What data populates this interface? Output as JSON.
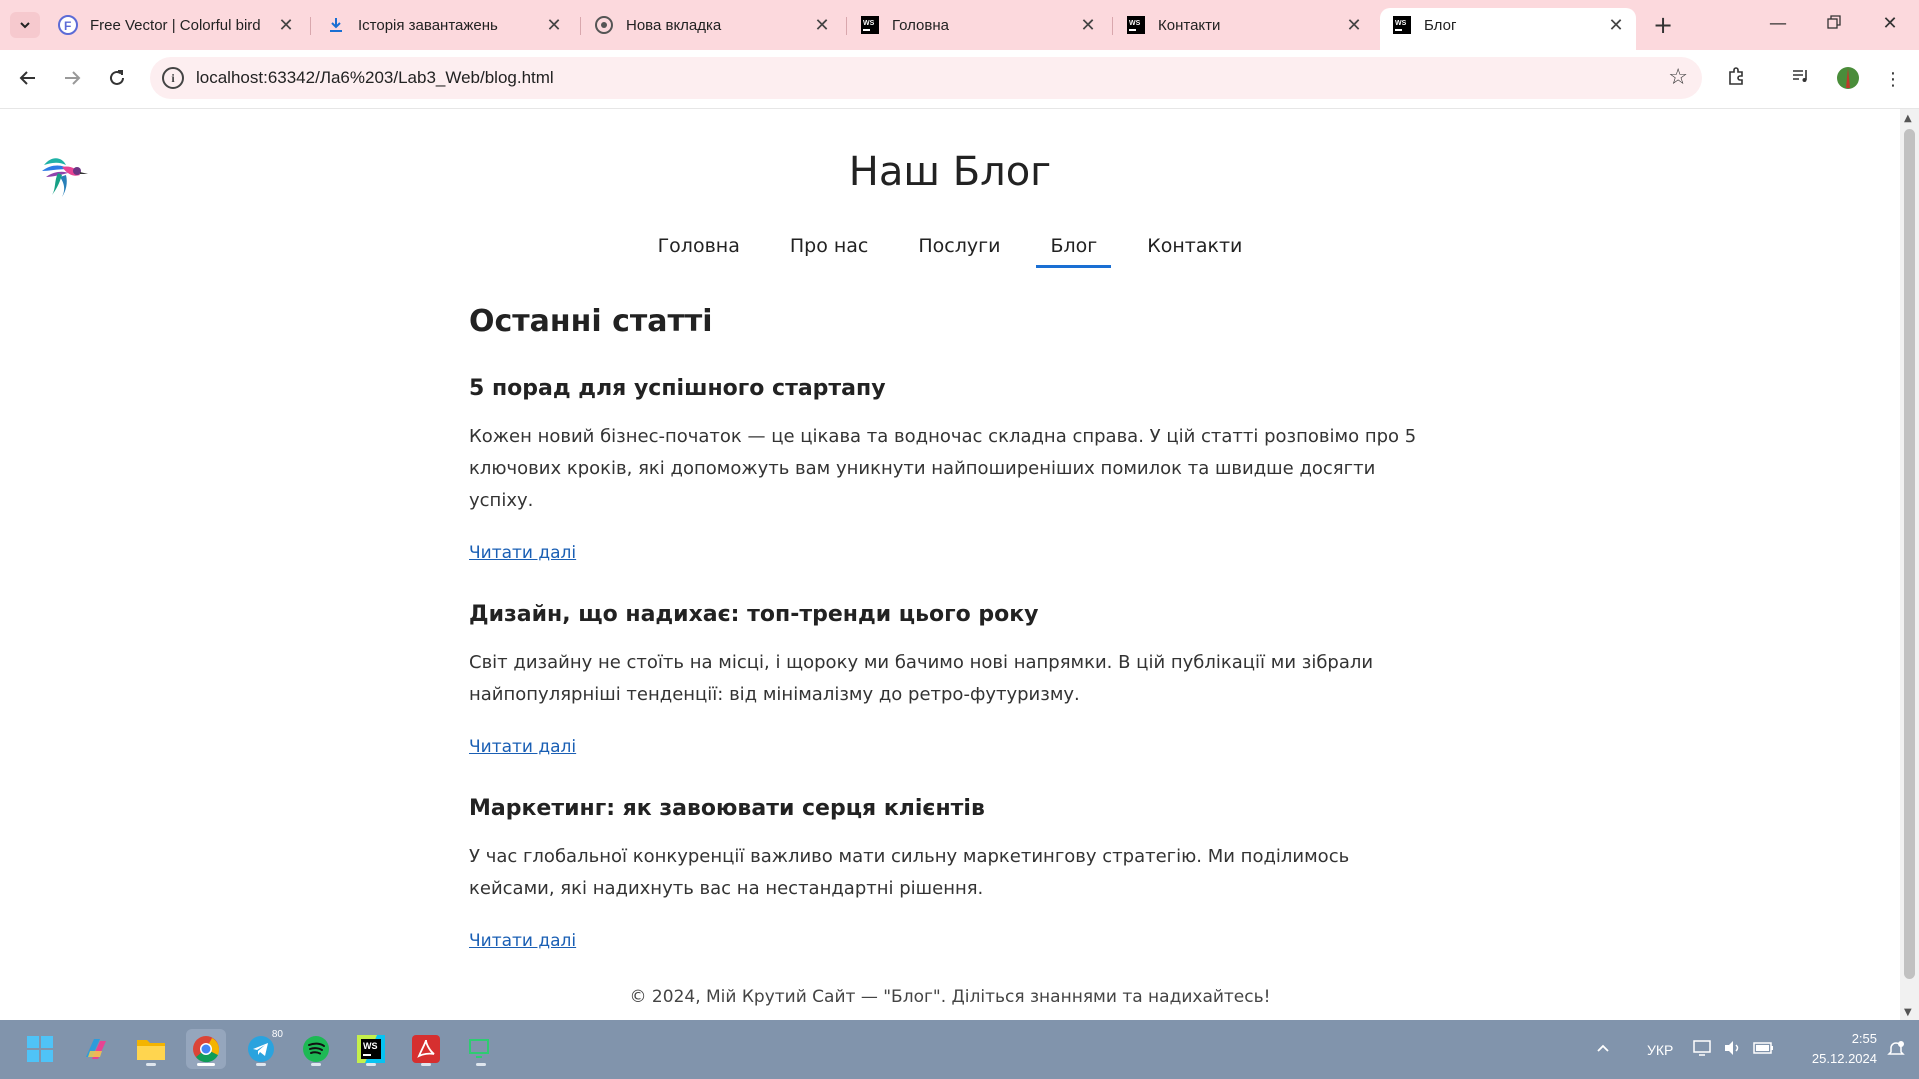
{
  "browser": {
    "tabs": [
      {
        "title": "Free Vector | Colorful bird",
        "icon": "freepik-icon",
        "active": false
      },
      {
        "title": "Історія завантажень",
        "icon": "download-icon",
        "active": false
      },
      {
        "title": "Нова вкладка",
        "icon": "chrome-icon",
        "active": false
      },
      {
        "title": "Головна",
        "icon": "webstorm-icon",
        "active": false
      },
      {
        "title": "Контакти",
        "icon": "webstorm-icon",
        "active": false
      },
      {
        "title": "Блог",
        "icon": "webstorm-icon",
        "active": true
      }
    ],
    "url": "localhost:63342/Ла6%203/Lab3_Web/blog.html",
    "accent_color": "#fcd9dd"
  },
  "page": {
    "site_title": "Наш Блог",
    "nav": [
      {
        "label": "Головна",
        "active": false
      },
      {
        "label": "Про нас",
        "active": false
      },
      {
        "label": "Послуги",
        "active": false
      },
      {
        "label": "Блог",
        "active": true
      },
      {
        "label": "Контакти",
        "active": false
      }
    ],
    "section_title": "Останні статті",
    "posts": [
      {
        "title": "5 порад для успішного стартапу",
        "text": "Кожен новий бізнес-початок — це цікава та водночас складна справа. У цій статті розповімо про 5 ключових кроків, які допоможуть вам уникнути найпоширеніших помилок та швидше досягти успіху.",
        "link": "Читати далі"
      },
      {
        "title": "Дизайн, що надихає: топ-тренди цього року",
        "text": "Світ дизайну не стоїть на місці, і щороку ми бачимо нові напрямки. В цій публікації ми зібрали найпопулярніші тенденції: від мінімалізму до ретро-футуризму.",
        "link": "Читати далі"
      },
      {
        "title": "Маркетинг: як завоювати серця клієнтів",
        "text": "У час глобальної конкуренції важливо мати сильну маркетингову стратегію. Ми поділимось кейсами, які надихнуть вас на нестандартні рішення.",
        "link": "Читати далі"
      }
    ],
    "footer": "© 2024, Мій Крутий Сайт — \"Блог\". Діліться знаннями та надихайтесь!",
    "link_color": "#1a5fb4"
  },
  "taskbar": {
    "apps": [
      "windows-start",
      "copilot",
      "file-explorer",
      "chrome",
      "telegram",
      "spotify",
      "webstorm",
      "acrobat",
      "screen-app"
    ],
    "telegram_badge": "80",
    "language": "УКР",
    "time": "2:55",
    "date": "25.12.2024"
  }
}
